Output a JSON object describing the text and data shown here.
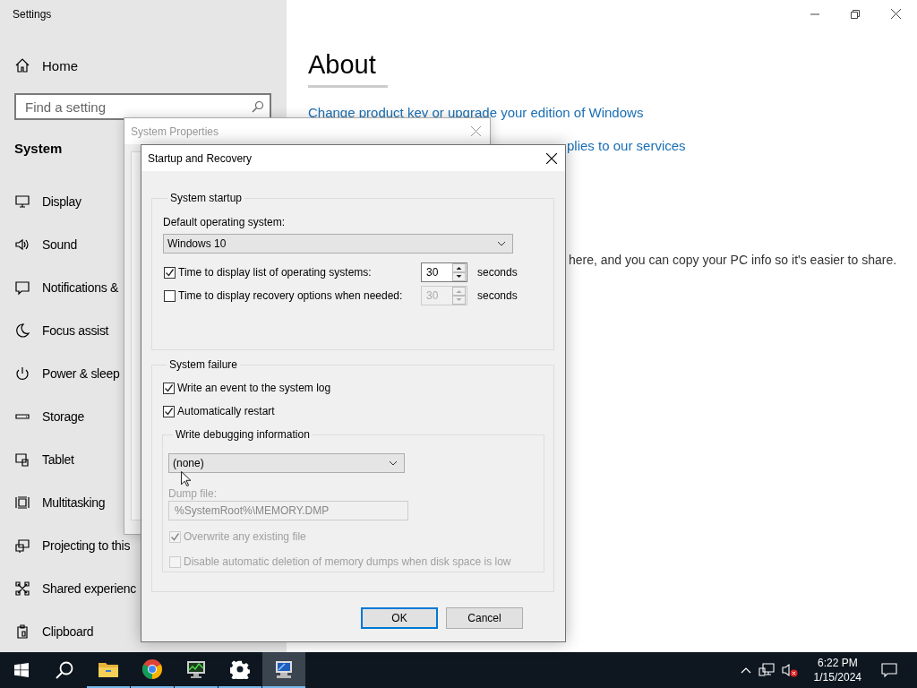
{
  "settings_window": {
    "title": "Settings",
    "home": "Home",
    "search": {
      "placeholder": "Find a setting"
    },
    "section": "System",
    "nav_items": [
      {
        "label": "Display"
      },
      {
        "label": "Sound"
      },
      {
        "label": "Notifications &"
      },
      {
        "label": "Focus assist"
      },
      {
        "label": "Power & sleep"
      },
      {
        "label": "Storage"
      },
      {
        "label": "Tablet"
      },
      {
        "label": "Multitasking"
      },
      {
        "label": "Projecting to this"
      },
      {
        "label": "Shared experienc"
      },
      {
        "label": "Clipboard"
      }
    ],
    "about": {
      "title": "About",
      "links": [
        "Change product key or upgrade your edition of Windows",
        "plies to our services"
      ],
      "text": "here, and you can copy your PC info so it's easier to share."
    }
  },
  "system_properties": {
    "title": "System Properties"
  },
  "startup_recovery": {
    "title": "Startup and Recovery",
    "system_startup": {
      "legend": "System startup",
      "default_os_label": "Default operating system:",
      "default_os": "Windows 10",
      "rows": [
        {
          "label": "Time to display list of operating systems:",
          "checked": true,
          "value": "30",
          "disabled": false,
          "unit": "seconds"
        },
        {
          "label": "Time to display recovery options when needed:",
          "checked": false,
          "value": "30",
          "disabled": true,
          "unit": "seconds"
        }
      ]
    },
    "system_failure": {
      "legend": "System failure",
      "options": [
        {
          "label": "Write an event to the system log",
          "checked": true,
          "disabled": false
        },
        {
          "label": "Automatically restart",
          "checked": true,
          "disabled": false
        }
      ],
      "debugging": {
        "legend": "Write debugging information",
        "type": "(none)",
        "dump_file_label": "Dump file:",
        "dump_file": "%SystemRoot%\\MEMORY.DMP",
        "dump_disabled": true,
        "options": [
          {
            "label": "Overwrite any existing file",
            "checked": true,
            "disabled": true
          },
          {
            "label": "Disable automatic deletion of memory dumps when disk space is low",
            "checked": false,
            "disabled": true
          }
        ]
      }
    },
    "buttons": [
      {
        "label": "OK",
        "default": true
      },
      {
        "label": "Cancel",
        "default": false
      }
    ]
  },
  "taskbar": {
    "apps": [
      {
        "open": true,
        "selected": false
      },
      {
        "open": true,
        "selected": false
      },
      {
        "open": true,
        "selected": false
      },
      {
        "open": true,
        "selected": false
      },
      {
        "open": true,
        "selected": true
      }
    ],
    "clock": {
      "time": "6:22 PM",
      "date": "1/15/2024"
    }
  }
}
